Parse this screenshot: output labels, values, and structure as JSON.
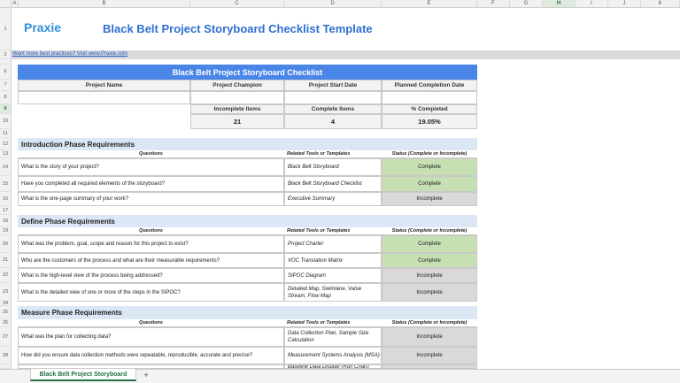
{
  "brand": {
    "logo": "Praxie"
  },
  "title": "Black Belt Project Storyboard Checklist Template",
  "link_text": "Want more best practices? Visit www.Praxie.com",
  "columns": [
    "A",
    "B",
    "C",
    "D",
    "E",
    "F",
    "G",
    "H",
    "I",
    "J",
    "K"
  ],
  "rows": [
    "1",
    "2",
    "6",
    "7",
    "8",
    "9",
    "10",
    "11",
    "12",
    "13",
    "14",
    "15",
    "16",
    "17",
    "18",
    "19",
    "20",
    "21",
    "22",
    "23",
    "24",
    "25",
    "26",
    "27",
    "28"
  ],
  "summary": {
    "banner": "Black Belt Project Storyboard Checklist",
    "headers": [
      "Project Name",
      "Project Champion",
      "Project Start Date",
      "Planned Completion Date"
    ],
    "stat_headers": [
      "Incomplete Items",
      "Complete Items",
      "% Completed"
    ],
    "stat_values": [
      "21",
      "4",
      "19.05%"
    ]
  },
  "table_headers": {
    "q": "Questions",
    "t": "Related Tools or Templates",
    "s": "Status (Complete or Incomplete)"
  },
  "sections": [
    {
      "title": "Introduction Phase Requirements",
      "rows": [
        {
          "q": "What is the story of your project?",
          "t": "Black Belt Storyboard",
          "s": "Complete"
        },
        {
          "q": "Have you completed all required elements of the storyboard?",
          "t": "Black Belt Storyboard Checklist",
          "s": "Complete"
        },
        {
          "q": "What is the one-page summary of your work?",
          "t": "Executive Summary",
          "s": "Incomplete"
        }
      ]
    },
    {
      "title": "Define Phase Requirements",
      "rows": [
        {
          "q": "What was the problem, goal, scope and reason for this project to exist?",
          "t": "Project Charter",
          "s": "Complete"
        },
        {
          "q": "Who are the customers of the process and what are their measurable requirements?",
          "t": "VOC Translation Matrix",
          "s": "Complete"
        },
        {
          "q": "What is the high-level view of the process being addressed?",
          "t": "SIPOC Diagram",
          "s": "Incomplete"
        },
        {
          "q": "What is the detailed view of one or more of the steps in the SIPOC?",
          "t": "Detailed Map, Swimlane, Value Stream, Flow Map",
          "s": "Incomplete"
        }
      ]
    },
    {
      "title": "Measure Phase Requirements",
      "rows": [
        {
          "q": "What was the plan for collecting data?",
          "t": "Data Collection Plan, Sample Size Calculation",
          "s": "Incomplete"
        },
        {
          "q": "How did you ensure data collection methods were repeatable, reproducible, accurate and precise?",
          "t": "Measurement Systems Analysis (MSA)",
          "s": "Incomplete"
        },
        {
          "q": "",
          "t": "Baseline Data Display (Run Chart)",
          "s": ""
        }
      ]
    }
  ],
  "sheet_tab": "Black Belt Project Storyboard",
  "add_tab": "+"
}
